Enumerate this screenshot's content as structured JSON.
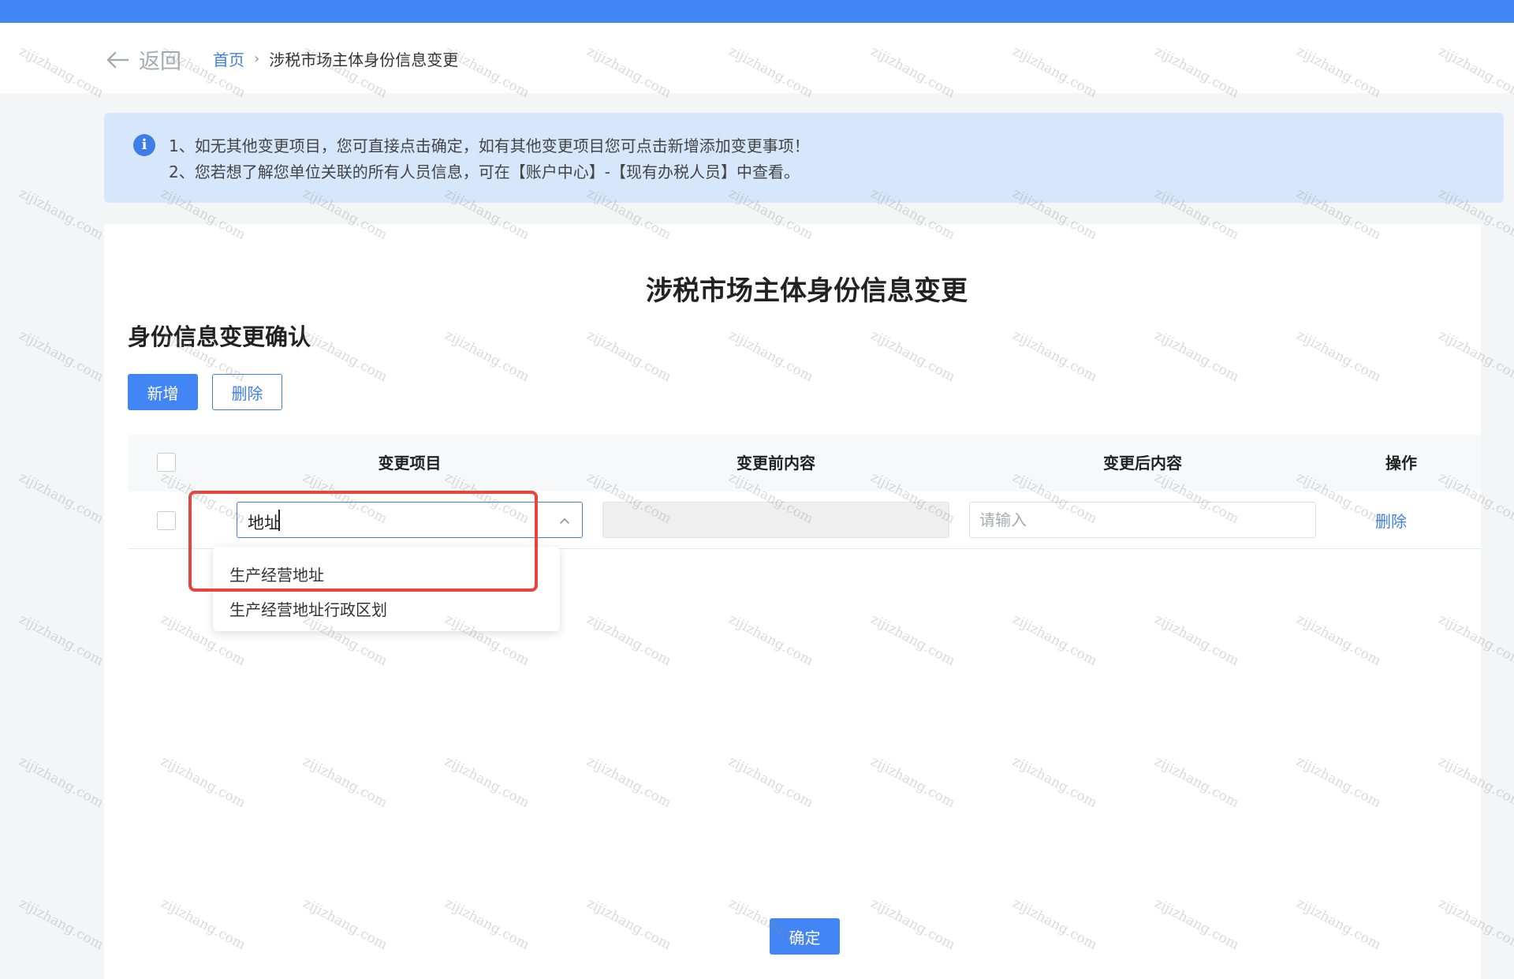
{
  "header": {
    "back_label": "返回",
    "breadcrumb": {
      "home": "首页",
      "separator": "›",
      "current": "涉税市场主体身份信息变更"
    }
  },
  "notice": {
    "icon": "info-icon",
    "line1": "1、如无其他变更项目，您可直接点击确定，如有其他变更项目您可点击新增添加变更事项！",
    "line2": "2、您若想了解您单位关联的所有人员信息，可在【账户中心】-【现有办税人员】中查看。"
  },
  "page": {
    "title": "涉税市场主体身份信息变更",
    "subtitle": "身份信息变更确认"
  },
  "toolbar": {
    "add_label": "新增",
    "delete_label": "删除"
  },
  "table": {
    "columns": [
      "变更项目",
      "变更前内容",
      "变更后内容",
      "操作"
    ],
    "rows": [
      {
        "item_value": "地址",
        "before_value": "",
        "after_placeholder": "请输入",
        "action_label": "删除"
      }
    ]
  },
  "dropdown": {
    "options": [
      "生产经营地址",
      "生产经营地址行政区划"
    ],
    "highlighted_option": "生产经营地址"
  },
  "footer": {
    "confirm_label": "确定"
  },
  "watermark": "zijizhang.com",
  "colors": {
    "primary": "#4286f5",
    "highlight_border": "#e7443e",
    "notice_bg": "#d6e7fc"
  }
}
